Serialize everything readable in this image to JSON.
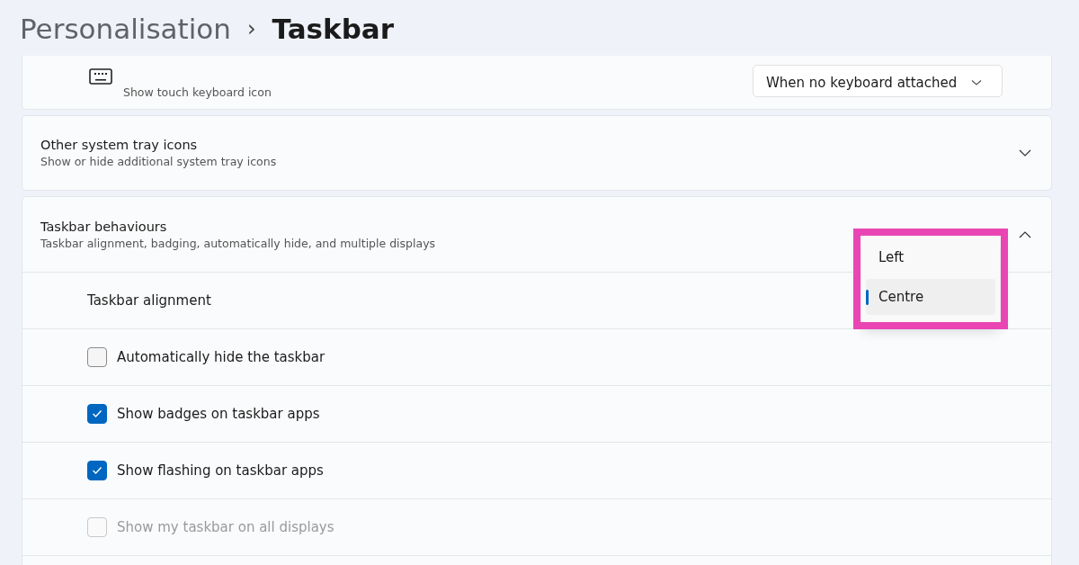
{
  "breadcrumb": {
    "parent": "Personalisation",
    "separator": "›",
    "current": "Taskbar"
  },
  "touch_keyboard": {
    "description": "Show touch keyboard icon",
    "dropdown_value": "When no keyboard attached"
  },
  "tray_icons": {
    "title": "Other system tray icons",
    "description": "Show or hide additional system tray icons",
    "expanded": false
  },
  "behaviours": {
    "title": "Taskbar behaviours",
    "description": "Taskbar alignment, badging, automatically hide, and multiple displays",
    "expanded": true,
    "alignment_label": "Taskbar alignment",
    "alignment_options": [
      {
        "label": "Left",
        "selected": false
      },
      {
        "label": "Centre",
        "selected": true
      }
    ],
    "options": [
      {
        "label": "Automatically hide the taskbar",
        "checked": false,
        "disabled": false
      },
      {
        "label": "Show badges on taskbar apps",
        "checked": true,
        "disabled": false
      },
      {
        "label": "Show flashing on taskbar apps",
        "checked": true,
        "disabled": false
      },
      {
        "label": "Show my taskbar on all displays",
        "checked": false,
        "disabled": true
      }
    ]
  }
}
